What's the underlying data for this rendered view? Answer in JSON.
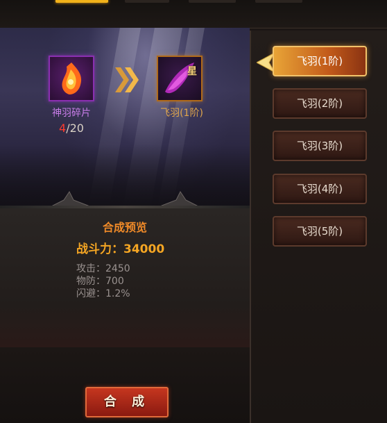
{
  "top_tabs": [
    {
      "name": "tab-1",
      "active": true
    },
    {
      "name": "tab-2",
      "active": false
    },
    {
      "name": "tab-3",
      "active": false
    },
    {
      "name": "tab-4",
      "active": false
    }
  ],
  "recipe": {
    "source_name": "神羽碎片",
    "have": "4",
    "sep_need": "/20",
    "target_name": "飞羽(1阶)",
    "target_badge": "星"
  },
  "preview": {
    "title": "合成预览",
    "power_label": "战斗力：",
    "power_value": "34000",
    "stats": [
      {
        "label": "攻击：",
        "value": "2450"
      },
      {
        "label": "物防：",
        "value": "700"
      },
      {
        "label": "闪避：",
        "value": "1.2%"
      }
    ]
  },
  "tiers": [
    {
      "label": "飞羽(1阶)",
      "active": true
    },
    {
      "label": "飞羽(2阶)",
      "active": false
    },
    {
      "label": "飞羽(3阶)",
      "active": false
    },
    {
      "label": "飞羽(4阶)",
      "active": false
    },
    {
      "label": "飞羽(5阶)",
      "active": false
    }
  ],
  "actions": {
    "synthesize": "合 成"
  },
  "colors": {
    "accent": "#f5a623",
    "rare": "#8a2fb0",
    "count_have": "#ff3b2e"
  }
}
